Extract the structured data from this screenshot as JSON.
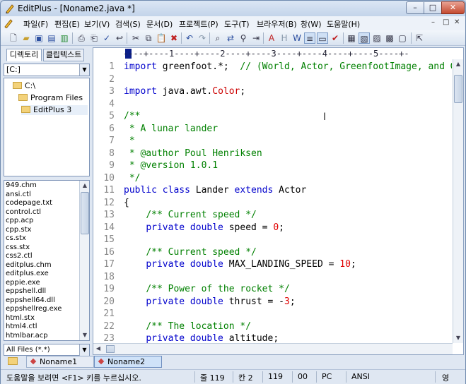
{
  "window": {
    "title": "EditPlus - [Noname2.java *]",
    "min_label": "–",
    "max_label": "□",
    "close_label": "✕"
  },
  "menu": [
    "파일(F)",
    "편집(E)",
    "보기(V)",
    "검색(S)",
    "문서(D)",
    "프로젝트(P)",
    "도구(T)",
    "브라우저(B)",
    "창(W)",
    "도움말(H)"
  ],
  "mdi_buttons": [
    "–",
    "□",
    "✕"
  ],
  "sidebar": {
    "tabs": [
      "디렉토리",
      "클립텍스트"
    ],
    "drive": "[C:]",
    "tree": [
      "C:\\",
      "Program Files",
      "EditPlus 3"
    ],
    "files": [
      "949.chm",
      "ansi.ctl",
      "codepage.txt",
      "control.ctl",
      "cpp.acp",
      "cpp.stx",
      "cs.stx",
      "css.stx",
      "css2.ctl",
      "editplus.chm",
      "editplus.exe",
      "eppie.exe",
      "eppshell.dll",
      "eppshell64.dll",
      "eppshellreg.exe",
      "html.stx",
      "html4.ctl",
      "htmlbar.acp"
    ],
    "filter": "All Files (*.*)"
  },
  "editor": {
    "ruler": "----+----1----+----2----+----3----+----4----+----5----+-",
    "lines": [
      {
        "n": "1",
        "segs": [
          [
            "kw",
            "import"
          ],
          [
            "",
            "greenfoot.*;  "
          ],
          [
            "cm",
            "// (World, Actor, GreenfootImage, and G"
          ]
        ]
      },
      {
        "n": "2",
        "segs": []
      },
      {
        "n": "3",
        "segs": [
          [
            "kw",
            "import"
          ],
          [
            "",
            "java.awt."
          ],
          [
            "cls",
            "Color"
          ],
          [
            "",
            ";"
          ]
        ]
      },
      {
        "n": "4",
        "segs": []
      },
      {
        "n": "5",
        "segs": [
          [
            "cm",
            "/**"
          ]
        ]
      },
      {
        "n": "6",
        "segs": [
          [
            "cm",
            " * A lunar lander"
          ]
        ]
      },
      {
        "n": "7",
        "segs": [
          [
            "cm",
            " *"
          ]
        ]
      },
      {
        "n": "8",
        "segs": [
          [
            "cm",
            " * @author Poul Henriksen"
          ]
        ]
      },
      {
        "n": "9",
        "segs": [
          [
            "cm",
            " * @version 1.0.1"
          ]
        ]
      },
      {
        "n": "10",
        "segs": [
          [
            "cm",
            " */"
          ]
        ]
      },
      {
        "n": "11",
        "segs": [
          [
            "kw",
            "public class"
          ],
          [
            "",
            " Lander "
          ],
          [
            "kw",
            "extends"
          ],
          [
            "",
            " Actor"
          ]
        ]
      },
      {
        "n": "12",
        "segs": [
          [
            "",
            "{"
          ]
        ]
      },
      {
        "n": "13",
        "segs": [
          [
            "",
            "    "
          ],
          [
            "cm",
            "/** Current speed */"
          ]
        ]
      },
      {
        "n": "14",
        "segs": [
          [
            "",
            "    "
          ],
          [
            "kw",
            "private double"
          ],
          [
            "",
            " speed = "
          ],
          [
            "num",
            "0"
          ],
          [
            "",
            ";"
          ]
        ]
      },
      {
        "n": "15",
        "segs": []
      },
      {
        "n": "16",
        "segs": [
          [
            "",
            "    "
          ],
          [
            "cm",
            "/** Current speed */"
          ]
        ]
      },
      {
        "n": "17",
        "segs": [
          [
            "",
            "    "
          ],
          [
            "kw",
            "private double"
          ],
          [
            "",
            " MAX_LANDING_SPEED = "
          ],
          [
            "num",
            "10"
          ],
          [
            "",
            ";"
          ]
        ]
      },
      {
        "n": "18",
        "segs": []
      },
      {
        "n": "19",
        "segs": [
          [
            "",
            "    "
          ],
          [
            "cm",
            "/** Power of the rocket */"
          ]
        ]
      },
      {
        "n": "20",
        "segs": [
          [
            "",
            "    "
          ],
          [
            "kw",
            "private double"
          ],
          [
            "",
            " thrust = -"
          ],
          [
            "num",
            "3"
          ],
          [
            "",
            ";"
          ]
        ]
      },
      {
        "n": "21",
        "segs": []
      },
      {
        "n": "22",
        "segs": [
          [
            "",
            "    "
          ],
          [
            "cm",
            "/** The location */"
          ]
        ]
      },
      {
        "n": "23",
        "segs": [
          [
            "",
            "    "
          ],
          [
            "kw",
            "private double"
          ],
          [
            "",
            " altitude;"
          ]
        ]
      }
    ]
  },
  "doc_tabs": [
    "Noname1",
    "Noname2"
  ],
  "status": {
    "hint": "도움말을 보려면 <F1> 키를 누르십시오.",
    "line": "줄 119",
    "col": "칸 2",
    "total": "119",
    "code": "00",
    "mode": "PC",
    "encoding": "ANSI",
    "ime": "영"
  }
}
